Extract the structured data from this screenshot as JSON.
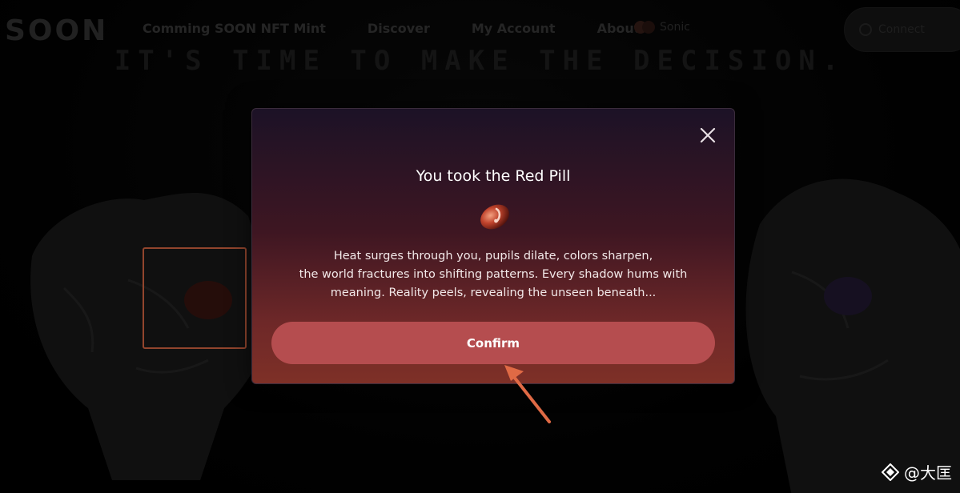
{
  "header": {
    "logo_text": "SOON",
    "nav": [
      {
        "label": "Comming SOON NFT Mint"
      },
      {
        "label": "Discover"
      },
      {
        "label": "My Account"
      },
      {
        "label": "About"
      }
    ],
    "partner_label": "Sonic",
    "wallet_button_label": "Connect"
  },
  "hero": {
    "title": "IT'S TIME TO MAKE THE DECISION."
  },
  "modal": {
    "title": "You took the Red Pill",
    "body_lines": [
      "Heat surges through you, pupils dilate, colors sharpen,",
      "the world fractures into shifting patterns. Every shadow hums with",
      "meaning. Reality peels, revealing the unseen beneath..."
    ],
    "confirm_label": "Confirm",
    "close_icon": "close-icon",
    "pill_icon": "red-pill-icon"
  },
  "watermark": {
    "handle": "@大匡"
  },
  "colors": {
    "accent": "#e06a45",
    "confirm_button": "#b54d4f",
    "modal_top": "#1c1226",
    "modal_bottom": "#7e3027"
  }
}
